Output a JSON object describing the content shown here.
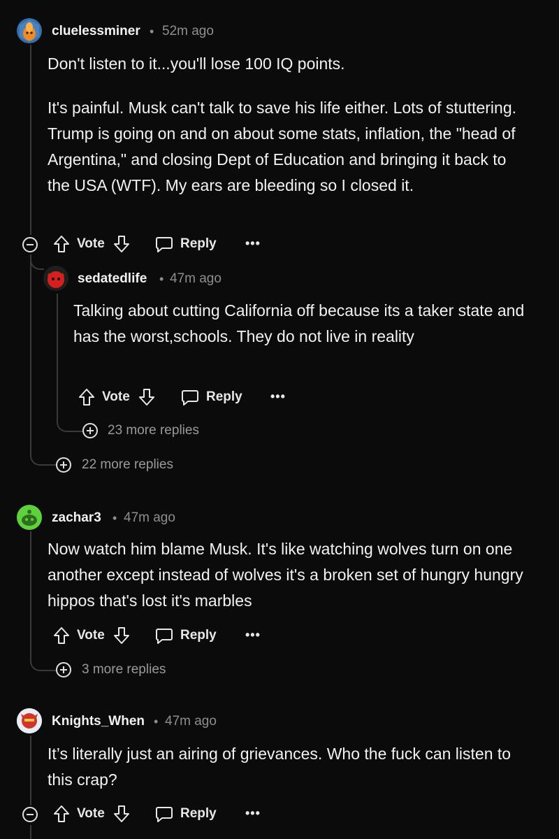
{
  "comments": [
    {
      "username": "cluelessminer",
      "time": "52m ago",
      "paragraphs": [
        "Don't listen to it...you'll lose 100 IQ points.",
        "It's painful. Musk can't talk to save his life either. Lots of stuttering. Trump is going on and on about some stats, inflation, the \"head of Argentina,\" and closing Dept of Education and bringing it back to the USA (WTF). My ears are bleeding so I closed it."
      ],
      "vote_label": "Vote",
      "reply_label": "Reply",
      "more_replies": "22 more replies"
    },
    {
      "username": "sedatedlife",
      "time": "47m ago",
      "paragraphs": [
        "Talking about cutting California off because its a taker state and has the worst,schools. They do not live in reality"
      ],
      "vote_label": "Vote",
      "reply_label": "Reply",
      "more_replies": "23 more replies"
    },
    {
      "username": "zachar3",
      "time": "47m ago",
      "paragraphs": [
        "Now watch him blame Musk. It's like watching wolves turn on one another except instead of wolves it's a broken set of hungry hungry hippos that's lost it's marbles"
      ],
      "vote_label": "Vote",
      "reply_label": "Reply",
      "more_replies": "3 more replies"
    },
    {
      "username": "Knights_When",
      "time": "47m ago",
      "paragraphs": [
        "It’s literally just an airing of grievances. Who the fuck can listen to this crap?"
      ],
      "vote_label": "Vote",
      "reply_label": "Reply"
    }
  ],
  "separator": "•",
  "overflow_label": "•••",
  "colors": {
    "background": "#0b0b0b",
    "text": "#f2f2f2",
    "muted": "#8e8e8e",
    "thread_line": "#3a3a3a"
  },
  "icons": {
    "upvote": "arrow-up-icon",
    "downvote": "arrow-down-icon",
    "reply": "speech-bubble-icon",
    "overflow": "ellipsis-icon",
    "collapse": "minus-circle-icon",
    "expand": "plus-circle-icon"
  }
}
